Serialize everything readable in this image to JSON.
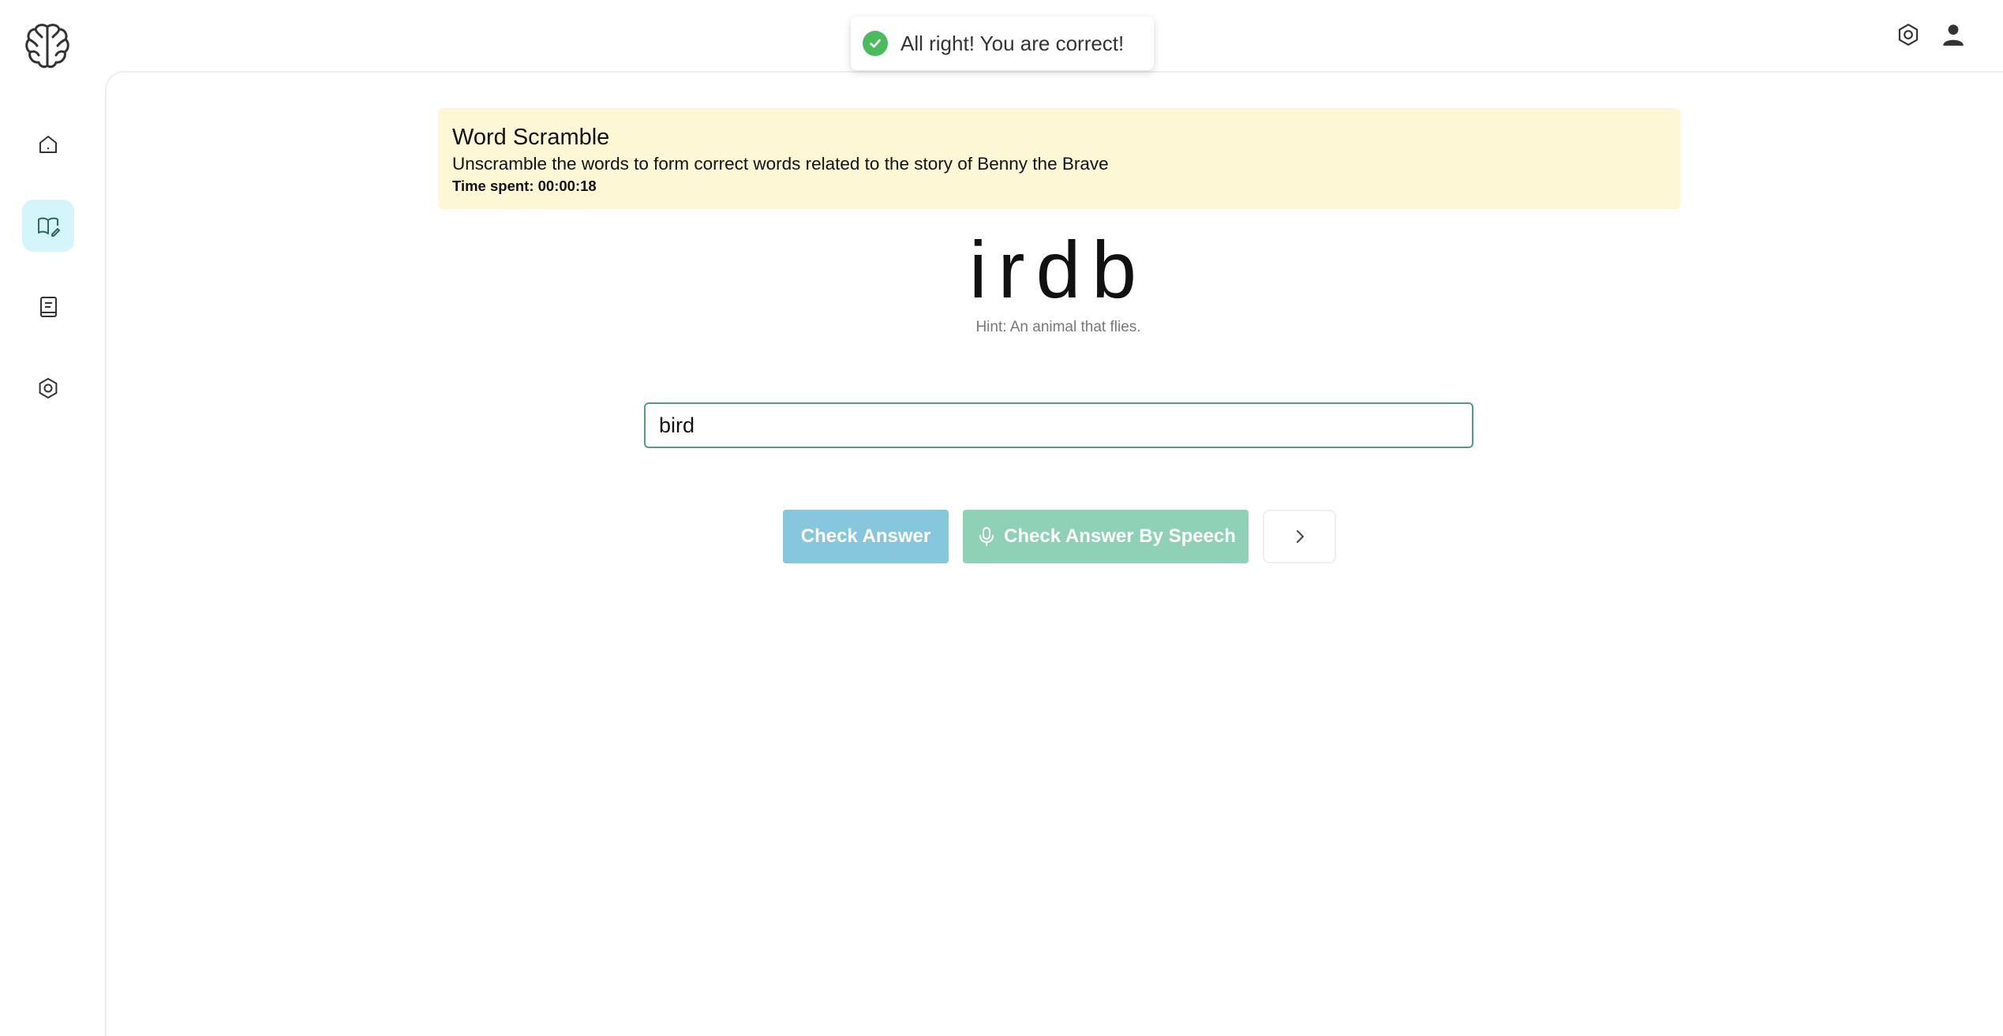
{
  "app": {
    "logo_icon": "brain-icon"
  },
  "sidebar": {
    "items": [
      {
        "icon": "home-icon",
        "active": false
      },
      {
        "icon": "book-edit-icon",
        "active": true
      },
      {
        "icon": "notebook-icon",
        "active": false
      },
      {
        "icon": "hexagon-settings-icon",
        "active": false
      }
    ],
    "active_color": "#d4f6fa"
  },
  "header": {
    "settings_icon": "hexagon-settings-icon",
    "user_icon": "user-icon"
  },
  "toast": {
    "icon": "check-circle-icon",
    "message": "All right! You are correct!",
    "color": "#4cbb5b"
  },
  "activity": {
    "title": "Word Scramble",
    "description": "Unscramble the words to form correct words related to the story of Benny the Brave",
    "time_spent": "Time spent: 00:00:18",
    "banner_color": "#fdf7d5"
  },
  "puzzle": {
    "scrambled_word": "irdb",
    "hint": "Hint: An animal that flies."
  },
  "answer": {
    "value": "bird",
    "border_color": "#4f9b8c"
  },
  "buttons": {
    "check_label": "Check Answer",
    "speech_label": "Check Answer By Speech",
    "speech_icon": "microphone-icon",
    "next_icon": "chevron-right-icon",
    "check_color": "#86c7dd",
    "speech_color": "#8fd1b6"
  }
}
